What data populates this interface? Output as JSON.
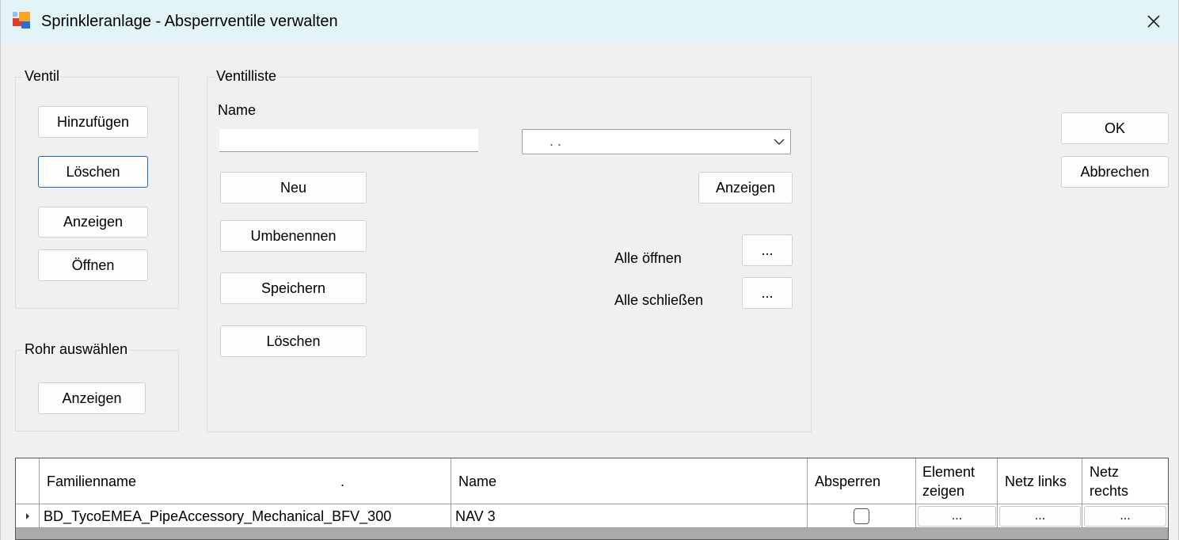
{
  "window": {
    "title": "Sprinkleranlage - Absperrventile verwalten",
    "close_icon": "close-icon",
    "app_icon": "windows-app-icon"
  },
  "ventil_group": {
    "legend": "Ventil",
    "buttons": {
      "add": "Hinzufügen",
      "delete": "Löschen",
      "show": "Anzeigen",
      "open": "Öffnen"
    }
  },
  "rohr_group": {
    "legend": "Rohr auswählen",
    "show": "Anzeigen"
  },
  "ventilliste_group": {
    "legend": "Ventilliste",
    "name_label": "Name",
    "name_value": "",
    "combo_value": ". .",
    "buttons": {
      "new": "Neu",
      "rename": "Umbenennen",
      "save": "Speichern",
      "delete": "Löschen",
      "show": "Anzeigen",
      "open_all": "...",
      "close_all": "..."
    },
    "open_all_label": "Alle öffnen",
    "close_all_label": "Alle schließen"
  },
  "dialog_buttons": {
    "ok": "OK",
    "cancel": "Abbrechen"
  },
  "grid": {
    "columns": [
      "Familienname",
      "Name",
      "Absperren",
      "Element zeigen",
      "Netz links",
      "Netz rechts"
    ],
    "header_dot": ".",
    "rows": [
      {
        "familienname": "BD_TycoEMEA_PipeAccessory_Mechanical_BFV_300",
        "name": "NAV 3",
        "absperren": false,
        "element_zeigen": "...",
        "netz_links": "...",
        "netz_rechts": "..."
      }
    ]
  }
}
